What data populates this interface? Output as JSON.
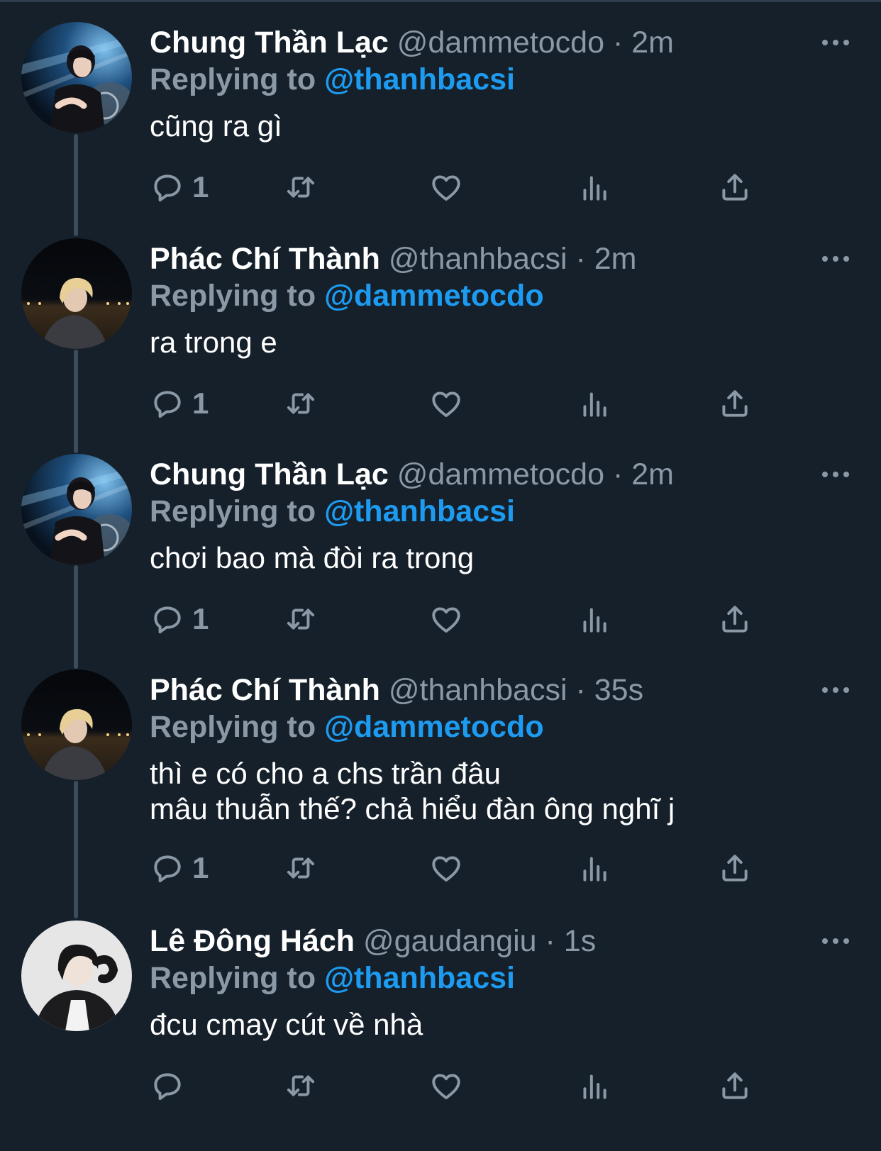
{
  "tweets": [
    {
      "name": "Chung Thần Lạc",
      "handle": "@dammetocdo",
      "time": "2m",
      "replying_label": "Replying to",
      "replying_to": "@thanhbacsi",
      "lines": [
        "cũng ra gì"
      ],
      "reply_count": "1",
      "avatar": "avatar-1"
    },
    {
      "name": "Phác Chí Thành",
      "handle": "@thanhbacsi",
      "time": "2m",
      "replying_label": "Replying to",
      "replying_to": "@dammetocdo",
      "lines": [
        "ra trong e"
      ],
      "reply_count": "1",
      "avatar": "avatar-2"
    },
    {
      "name": "Chung Thần Lạc",
      "handle": "@dammetocdo",
      "time": "2m",
      "replying_label": "Replying to",
      "replying_to": "@thanhbacsi",
      "lines": [
        "chơi bao mà đòi ra trong"
      ],
      "reply_count": "1",
      "avatar": "avatar-1"
    },
    {
      "name": "Phác Chí Thành",
      "handle": "@thanhbacsi",
      "time": "35s",
      "replying_label": "Replying to",
      "replying_to": "@dammetocdo",
      "lines": [
        "thì e có cho a chs trần đâu",
        "mâu thuẫn thế? chả hiểu đàn ông nghĩ j"
      ],
      "reply_count": "1",
      "avatar": "avatar-2"
    },
    {
      "name": "Lê Đông Hách",
      "handle": "@gaudangiu",
      "time": "1s",
      "replying_label": "Replying to",
      "replying_to": "@thanhbacsi",
      "lines": [
        "đcu cmay cút về nhà"
      ],
      "reply_count": "",
      "avatar": "avatar-3"
    }
  ],
  "separator": "·",
  "colors": {
    "background": "#15202b",
    "text": "#ffffff",
    "muted": "#8b98a5",
    "accent": "#1d9bf0",
    "thread_line": "#3d4c5c"
  },
  "icons": [
    "more-icon",
    "reply-icon",
    "retweet-icon",
    "like-icon",
    "views-icon",
    "share-icon"
  ]
}
